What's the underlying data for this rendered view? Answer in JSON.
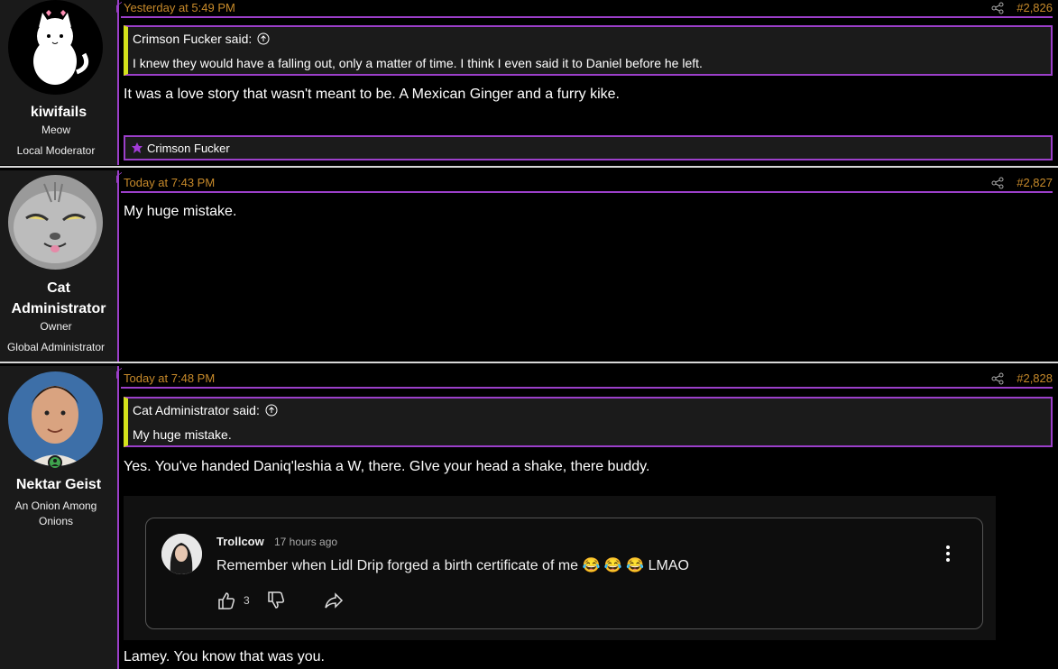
{
  "posts": [
    {
      "author": "kiwifails",
      "user_title": "Meow",
      "banner": "Local Moderator",
      "date": "Yesterday at 5:49 PM",
      "number": "#2,826",
      "quote": {
        "author_line": "Crimson Fucker said:",
        "text": "I knew they would have a falling out, only a matter of time. I think I even said it to Daniel before he left."
      },
      "text": "It was a love story that wasn't meant to be. A Mexican Ginger and a furry kike.",
      "reaction_user": "Crimson Fucker"
    },
    {
      "author_line1": "Cat",
      "author_line2": "Administrator",
      "user_title": "Owner",
      "banner": "Global Administrator",
      "date": "Today at 7:43 PM",
      "number": "#2,827",
      "text": "My huge mistake."
    },
    {
      "author": "Nektar Geist",
      "user_title": "An Onion Among Onions",
      "date": "Today at 7:48 PM",
      "number": "#2,828",
      "quote": {
        "author_line": "Cat Administrator said:",
        "text": "My huge mistake."
      },
      "text": "Yes. You've handed Daniq'leshia a W, there. GIve your head a shake, there buddy.",
      "embed": {
        "user": "Trollcow",
        "time": "17 hours ago",
        "comment": "Remember when Lidl Drip forged a birth certificate of me 😂 😂 😂 LMAO",
        "likes": "3"
      },
      "text2": "Lamey. You know that was you."
    }
  ],
  "colors": {
    "accent": "#9b3fc9",
    "date": "#c78a2a",
    "quote_bar": "#d4e21b"
  }
}
